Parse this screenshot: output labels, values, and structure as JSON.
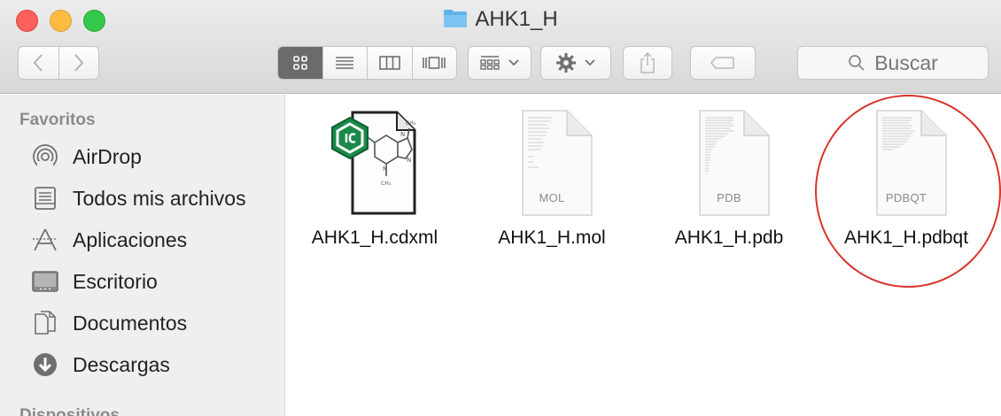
{
  "window": {
    "title": "AHK1_H",
    "title_icon": "folder-icon"
  },
  "toolbar": {
    "back_icon": "chevron-left-icon",
    "forward_icon": "chevron-right-icon",
    "views": [
      "icon-view-icon",
      "list-view-icon",
      "column-view-icon",
      "coverflow-view-icon"
    ],
    "selected_view": "icon-view-icon",
    "arrange_icon": "arrange-grid-icon",
    "action_icon": "gear-icon",
    "share_icon": "share-icon",
    "tag_icon": "tag-icon",
    "search_placeholder": "Buscar"
  },
  "sidebar": {
    "favorites_header": "Favoritos",
    "items": [
      {
        "label": "AirDrop",
        "icon": "airdrop-icon"
      },
      {
        "label": "Todos mis archivos",
        "icon": "all-files-icon"
      },
      {
        "label": "Aplicaciones",
        "icon": "applications-icon"
      },
      {
        "label": "Escritorio",
        "icon": "desktop-icon"
      },
      {
        "label": "Documentos",
        "icon": "documents-icon"
      },
      {
        "label": "Descargas",
        "icon": "downloads-icon"
      }
    ],
    "devices_header": "Dispositivos"
  },
  "files": [
    {
      "name": "AHK1_H.cdxml",
      "ext": "",
      "icon": "chemdraw-document-icon"
    },
    {
      "name": "AHK1_H.mol",
      "ext": "MOL",
      "icon": "document-icon"
    },
    {
      "name": "AHK1_H.pdb",
      "ext": "PDB",
      "icon": "document-icon"
    },
    {
      "name": "AHK1_H.pdbqt",
      "ext": "PDBQT",
      "icon": "document-icon"
    }
  ],
  "annotation": {
    "circled_file": "AHK1_H.pdbqt",
    "color": "#d9332a"
  },
  "colors": {
    "accent_folder": "#5fb3ea",
    "selected_view_bg": "#6b6b6b"
  }
}
